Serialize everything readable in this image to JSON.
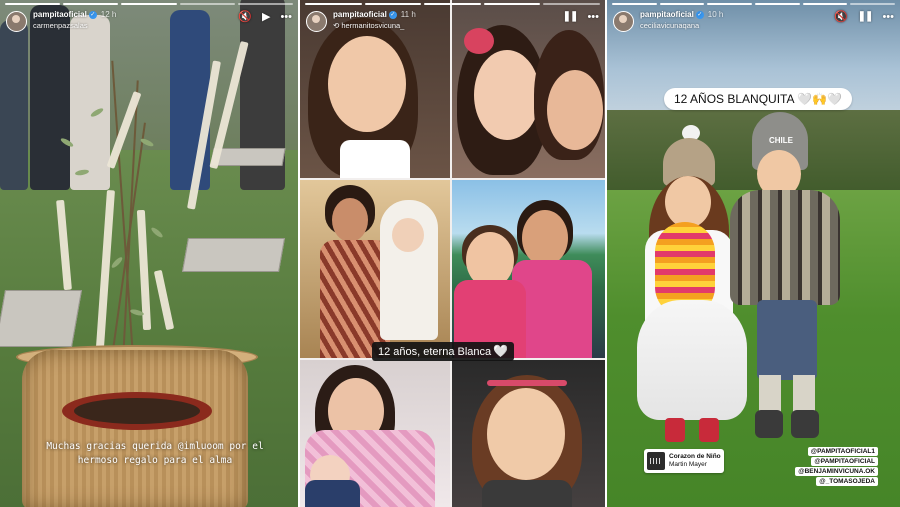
{
  "stories": [
    {
      "username": "pampitaoficial",
      "time": "12 h",
      "subline": "carmenpazsalas",
      "caption": "Muchas gracias querida @imluoom por el hermoso regalo para el alma"
    },
    {
      "username": "pampitaoficial",
      "time": "11 h",
      "subline": "hermanitosvicuna_",
      "caption": "12 años, eterna Blanca"
    },
    {
      "username": "pampitaoficial",
      "time": "10 h",
      "subline": "ceciliavicunaqana",
      "caption": "12 AÑOS BLANQUITA",
      "caption_emoji": "🤍🙌🤍",
      "music": {
        "title": "Corazon de Niño",
        "artist": "Martin Mayer"
      },
      "mentions": [
        "@PAMPITAOFICIAL1",
        "@PAMPITAOFICIAL",
        "@BENJAMINVICUNA.OK",
        "@_TOMASOJEDA"
      ],
      "poncho_text": "CHILE"
    }
  ],
  "controls": {
    "mute_icon": "speaker-muted-icon",
    "pause_icon": "pause-icon",
    "more_icon": "more-dots-icon"
  },
  "colors": {
    "verified": "#3897f0"
  }
}
